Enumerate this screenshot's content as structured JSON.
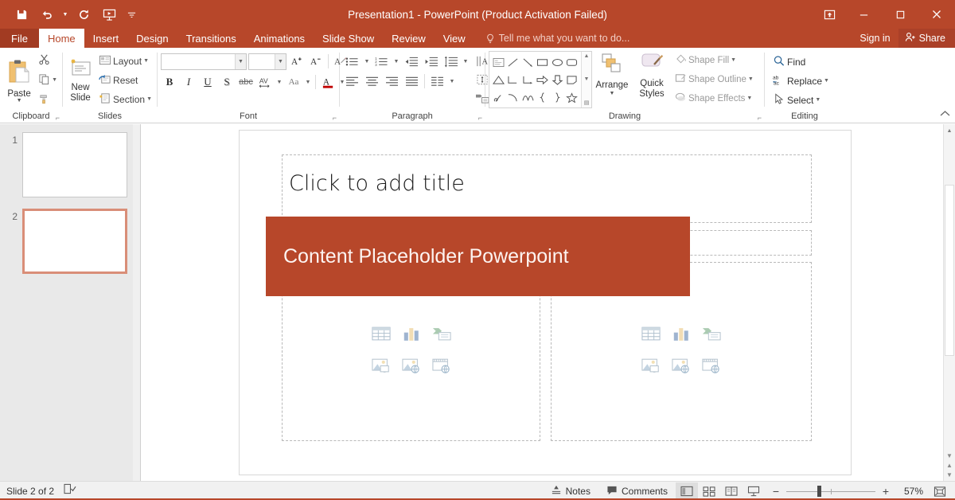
{
  "app": {
    "title": "Presentation1 - PowerPoint (Product Activation Failed)",
    "accent_color": "#b7472a",
    "file_tab_color": "#a23b22"
  },
  "quick_access": [
    {
      "name": "save",
      "label": "Save",
      "icon": "save-icon"
    },
    {
      "name": "undo",
      "label": "Undo",
      "icon": "undo-icon"
    },
    {
      "name": "redo",
      "label": "Redo",
      "icon": "redo-icon"
    },
    {
      "name": "start-slideshow",
      "label": "Start From Beginning",
      "icon": "slideshow-icon"
    },
    {
      "name": "customize-qat",
      "label": "Customize Quick Access Toolbar",
      "icon": "chevron-down-icon"
    }
  ],
  "window_controls": [
    {
      "name": "ribbon-display-options",
      "label": "Ribbon Display Options",
      "icon": "ribbon-options-icon"
    },
    {
      "name": "minimize",
      "label": "Minimize",
      "icon": "minimize-icon"
    },
    {
      "name": "restore",
      "label": "Restore Down",
      "icon": "restore-icon"
    },
    {
      "name": "close",
      "label": "Close",
      "icon": "close-icon"
    }
  ],
  "tabs": [
    {
      "label": "File",
      "active": false,
      "file": true
    },
    {
      "label": "Home",
      "active": true,
      "file": false
    },
    {
      "label": "Insert",
      "active": false,
      "file": false
    },
    {
      "label": "Design",
      "active": false,
      "file": false
    },
    {
      "label": "Transitions",
      "active": false,
      "file": false
    },
    {
      "label": "Animations",
      "active": false,
      "file": false
    },
    {
      "label": "Slide Show",
      "active": false,
      "file": false
    },
    {
      "label": "Review",
      "active": false,
      "file": false
    },
    {
      "label": "View",
      "active": false,
      "file": false
    }
  ],
  "tellme": {
    "placeholder": "Tell me what you want to do..."
  },
  "account": {
    "sign_in": "Sign in",
    "share": "Share"
  },
  "ribbon": {
    "clipboard": {
      "label": "Clipboard",
      "paste": "Paste",
      "cut": "Cut",
      "copy": "Copy",
      "format_painter": "Format Painter"
    },
    "slides": {
      "label": "Slides",
      "new_slide": "New\nSlide",
      "new_slide_line1": "New",
      "new_slide_line2": "Slide",
      "layout": "Layout",
      "reset": "Reset",
      "section": "Section"
    },
    "font": {
      "label": "Font",
      "font_name_value": "",
      "font_size_value": "",
      "grow_font": "A",
      "shrink_font": "A",
      "clear_formatting": "Clear All Formatting",
      "bold": "B",
      "italic": "I",
      "underline": "U",
      "shadow": "S",
      "strikethrough": "abc",
      "character_spacing": "AV",
      "change_case": "Aa",
      "font_color": "A"
    },
    "paragraph": {
      "label": "Paragraph",
      "bullets": "Bullets",
      "numbering": "Numbering",
      "decrease_indent": "Decrease List Level",
      "increase_indent": "Increase List Level",
      "line_spacing": "Line Spacing",
      "align_left": "Align Left",
      "center": "Center",
      "align_right": "Align Right",
      "justify": "Justify",
      "columns": "Add or Remove Columns",
      "text_direction": "Text Direction",
      "align_text": "Align Text",
      "convert_smartart": "Convert to SmartArt"
    },
    "drawing": {
      "label": "Drawing",
      "arrange": "Arrange",
      "quick_styles_line1": "Quick",
      "quick_styles_line2": "Styles",
      "shape_fill": "Shape Fill",
      "shape_outline": "Shape Outline",
      "shape_effects": "Shape Effects",
      "shapes": [
        "text-box",
        "line",
        "arrow-line",
        "rectangle",
        "oval",
        "rounded-rectangle",
        "triangle",
        "elbow-connector",
        "elbow-arrow-connector",
        "right-arrow",
        "down-arrow",
        "flowchart-shape",
        "scribble",
        "arc",
        "curve",
        "left-brace",
        "right-brace",
        "star"
      ]
    },
    "editing": {
      "label": "Editing",
      "find": "Find",
      "replace": "Replace",
      "select": "Select"
    },
    "collapse_ribbon": "Collapse the Ribbon"
  },
  "thumbnails": [
    {
      "number": "1",
      "selected": false
    },
    {
      "number": "2",
      "selected": true
    }
  ],
  "slide": {
    "title_placeholder": "Click to add title",
    "banner_text": "Content Placeholder Powerpoint",
    "banner_color": "#b7472a",
    "content_icons": [
      "insert-table-icon",
      "insert-chart-icon",
      "insert-smartart-icon",
      "insert-picture-icon",
      "insert-online-picture-icon",
      "insert-video-icon"
    ]
  },
  "statusbar": {
    "slide_count": "Slide 2 of 2",
    "accessibility": "Accessibility Checker",
    "notes": "Notes",
    "comments": "Comments",
    "views": [
      {
        "name": "normal-view",
        "label": "Normal",
        "active": true
      },
      {
        "name": "slide-sorter-view",
        "label": "Slide Sorter",
        "active": false
      },
      {
        "name": "reading-view",
        "label": "Reading View",
        "active": false
      },
      {
        "name": "slide-show-view",
        "label": "Slide Show",
        "active": false
      }
    ],
    "zoom_out": "−",
    "zoom_in": "+",
    "zoom_level": "57%",
    "fit_to_window": "Fit slide to current window"
  }
}
